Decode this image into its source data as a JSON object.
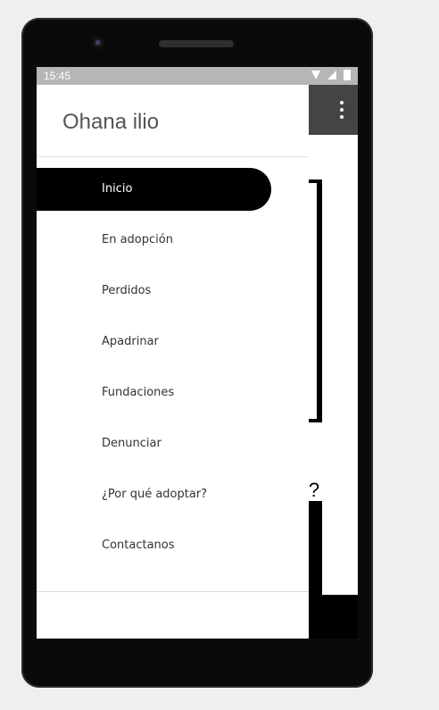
{
  "status_bar": {
    "time": "15:45",
    "icons": [
      "wifi-icon",
      "signal-icon",
      "battery-icon"
    ]
  },
  "drawer": {
    "title": "Ohana ilio",
    "items": [
      {
        "label": "Inicio",
        "active": true
      },
      {
        "label": "En adopción",
        "active": false
      },
      {
        "label": "Perdidos",
        "active": false
      },
      {
        "label": "Apadrinar",
        "active": false
      },
      {
        "label": "Fundaciones",
        "active": false
      },
      {
        "label": "Denunciar",
        "active": false
      },
      {
        "label": "¿Por qué adoptar?",
        "active": false
      },
      {
        "label": "Contactanos",
        "active": false
      }
    ]
  },
  "content": {
    "question_fragment": "l?"
  },
  "colors": {
    "status_bar": "#b6b6b6",
    "appbar": "#444444",
    "active_item_bg": "#000000",
    "title_text": "#555555"
  }
}
